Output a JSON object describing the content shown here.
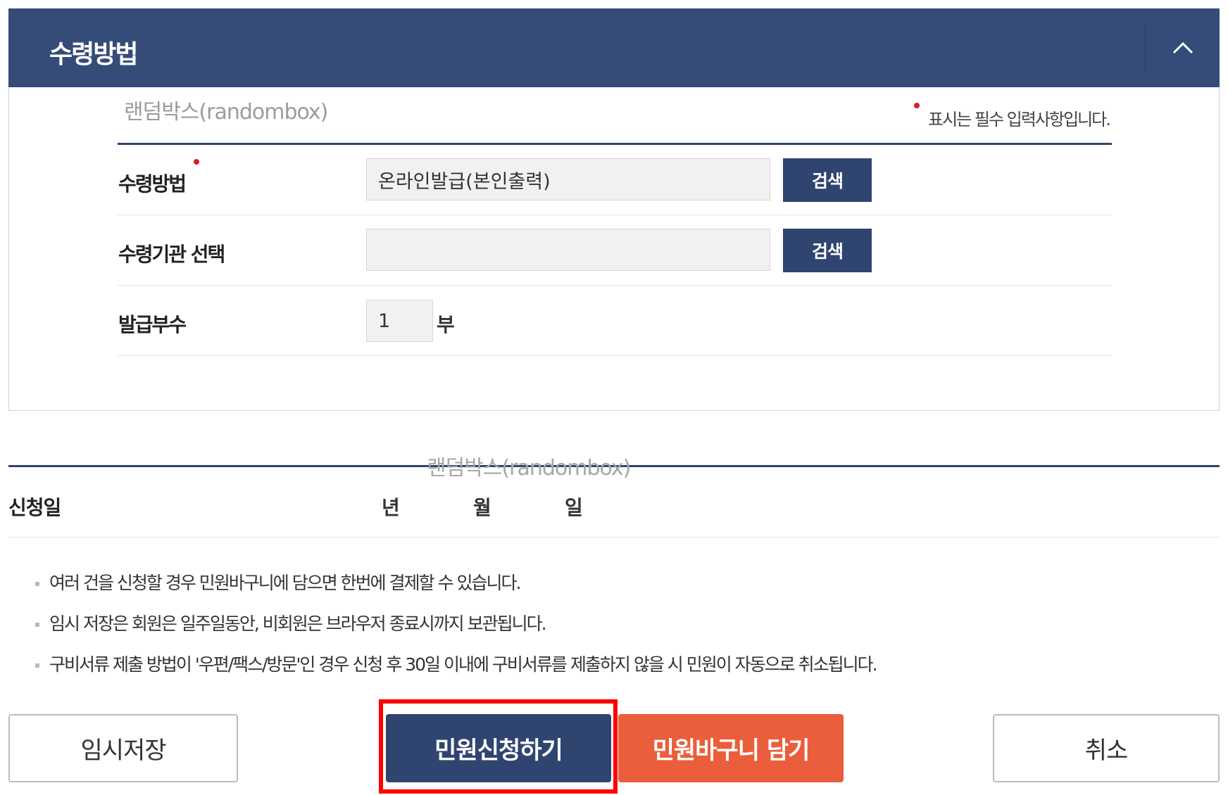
{
  "panel": {
    "title": "수령방법",
    "collapse_icon": "chevron-up-icon"
  },
  "watermarks": [
    "랜덤박스(randombox)",
    "랜덤박스(randombox)"
  ],
  "required_note": "표시는 필수 입력사항입니다.",
  "form": {
    "rows": [
      {
        "label": "수령방법",
        "value": "온라인발급(본인출력)",
        "button": "검색"
      },
      {
        "label": "수령기관 선택",
        "value": "",
        "button": "검색"
      },
      {
        "label": "발급부수",
        "value": "1",
        "unit": "부"
      }
    ]
  },
  "date": {
    "label": "신청일",
    "year_unit": "년",
    "month_unit": "월",
    "day_unit": "일"
  },
  "notes": [
    "여러 건을 신청할 경우 민원바구니에 담으면 한번에 결제할 수 있습니다.",
    "임시 저장은 회원은 일주일동안, 비회원은 브라우저 종료시까지 보관됩니다.",
    "구비서류 제출 방법이 '우편/팩스/방문'인 경우 신청 후 30일 이내에 구비서류를 제출하지 않을 시 민원이 자동으로 취소됩니다."
  ],
  "buttons": {
    "temp_save": "임시저장",
    "apply": "민원신청하기",
    "add_basket": "민원바구니 담기",
    "cancel": "취소"
  },
  "colors": {
    "header": "#354c79",
    "primary": "#2f4570",
    "orange": "#ea5e3c",
    "required": "#e11b22",
    "highlight": "#ff0000"
  }
}
